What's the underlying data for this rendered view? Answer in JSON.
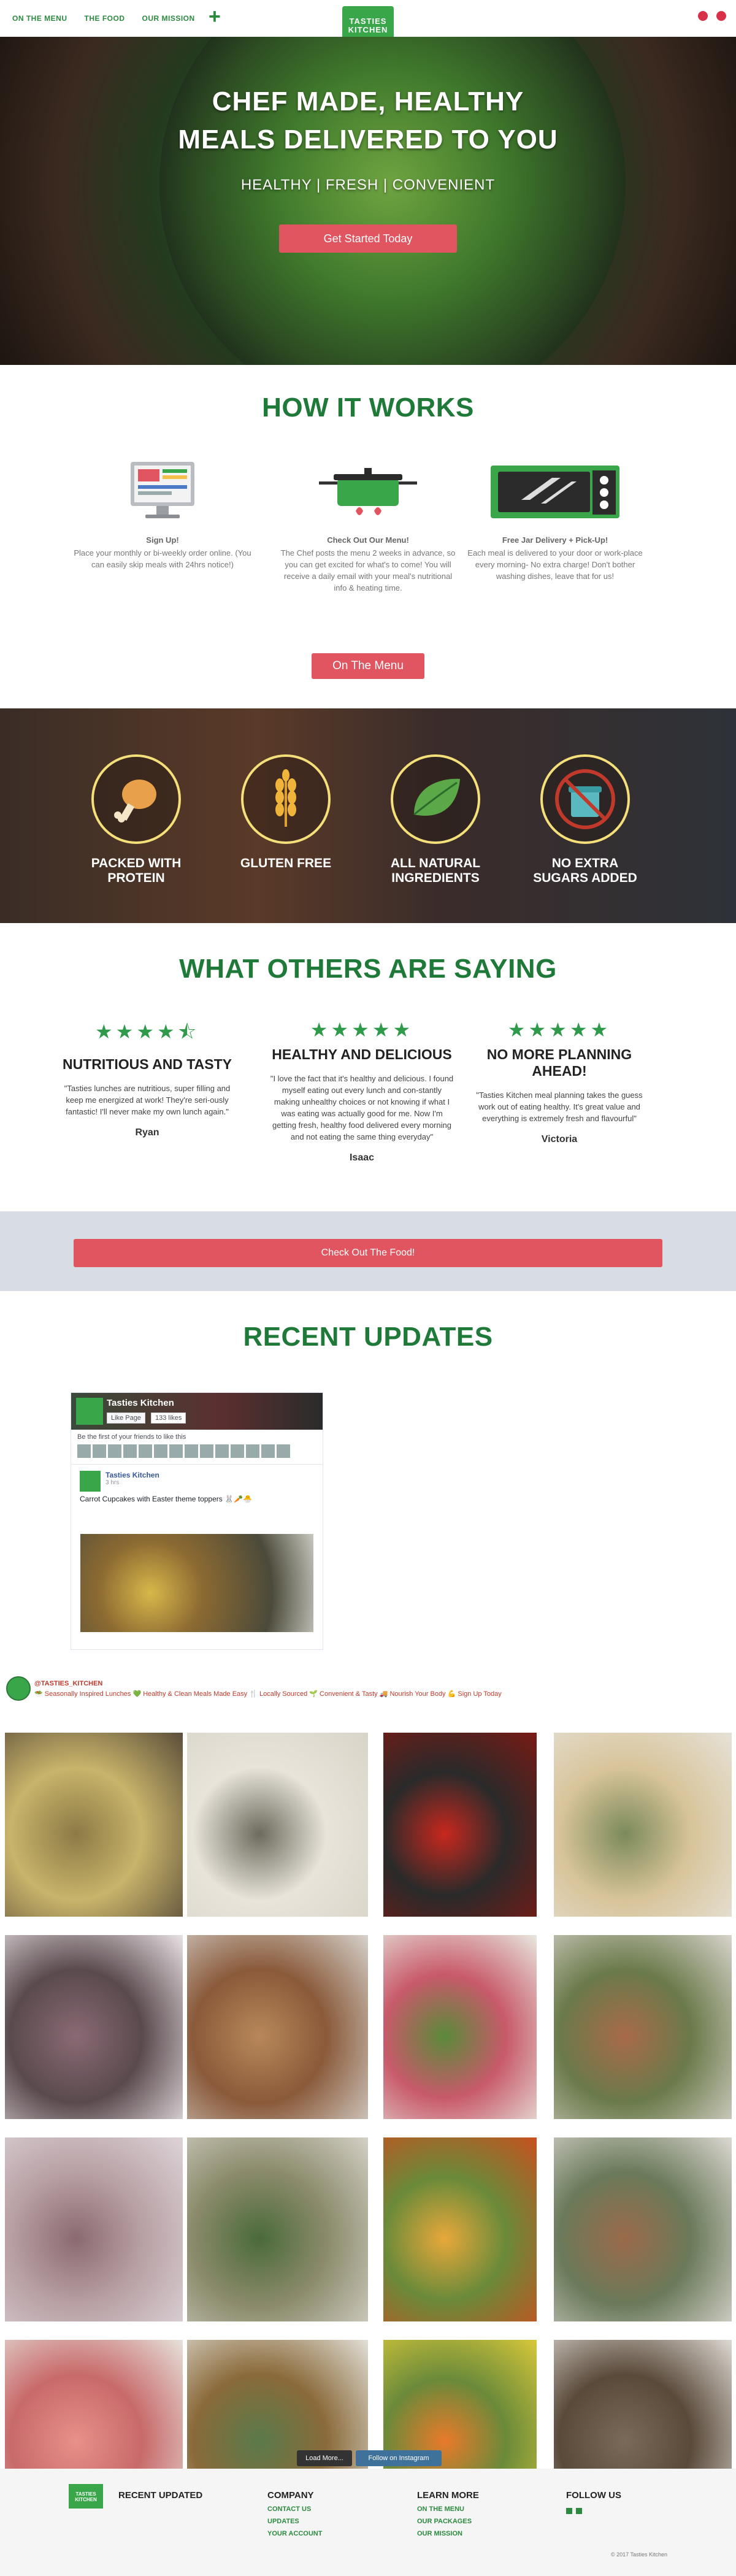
{
  "nav": {
    "items": [
      "ON THE MENU",
      "THE FOOD",
      "OUR MISSION"
    ],
    "logo_line1": "TASTIES",
    "logo_line2": "KITCHEN"
  },
  "hero": {
    "title_line1": "CHEF MADE, HEALTHY",
    "title_line2": "MEALS DELIVERED TO YOU",
    "subtitle": "HEALTHY | FRESH | CONVENIENT",
    "button": "Get Started Today"
  },
  "how": {
    "title": "HOW IT WORKS",
    "steps": [
      {
        "heading": "Sign Up!",
        "text": "Place your monthly or bi-weekly order online. (You can easily skip meals with 24hrs notice!)",
        "icon": "computer-icon"
      },
      {
        "heading": "Check Out Our Menu!",
        "text": "The Chef posts the menu 2 weeks in advance, so you can get excited for what's to come! You will receive a daily email with your meal's nutritional info & heating time.",
        "icon": "pot-icon"
      },
      {
        "heading": "Free Jar Delivery + Pick-Up!",
        "text": "Each meal is delivered to your door or work-place every morning- No extra charge! Don't bother washing dishes, leave that for us!",
        "icon": "microwave-icon"
      }
    ],
    "button": "On The Menu"
  },
  "features": [
    {
      "label": "PACKED WITH PROTEIN",
      "icon": "drumstick-icon"
    },
    {
      "label": "GLUTEN FREE",
      "icon": "wheat-icon"
    },
    {
      "label": "ALL NATURAL INGREDIENTS",
      "icon": "leaf-icon"
    },
    {
      "label": "NO EXTRA SUGARS ADDED",
      "icon": "no-sugar-icon"
    }
  ],
  "testimonials": {
    "title": "WHAT OTHERS ARE SAYING",
    "items": [
      {
        "stars": "★★★★⯪",
        "heading": "NUTRITIOUS AND TASTY",
        "text": "\"Tasties lunches are nutritious, super filling and keep me energized at work! They're seri-ously fantastic! I'll never make my own lunch again.\"",
        "name": "Ryan"
      },
      {
        "stars": "★★★★★",
        "heading": "HEALTHY AND DELICIOUS",
        "text": "\"I love the fact that it's healthy and delicious. I found myself eating out every lunch and con-stantly making unhealthy choices or not knowing if what I was eating was actually good for me. Now I'm getting fresh, healthy food delivered every morning and not eating the same thing everyday\"",
        "name": "Isaac"
      },
      {
        "stars": "★★★★★",
        "heading": "NO MORE PLANNING AHEAD!",
        "text": "\"Tasties Kitchen meal planning takes the guess work out of eating healthy. It's great value and everything is extremely fresh and flavourful\"",
        "name": "Victoria"
      }
    ]
  },
  "cta": {
    "button": "Check Out The Food!"
  },
  "updates": {
    "title": "RECENT UPDATES",
    "fb": {
      "page_name": "Tasties Kitchen",
      "like": "Like Page",
      "likes": "133 likes",
      "friends": "Be the first of your friends to like this",
      "post_name": "Tasties Kitchen",
      "post_time": "3 hrs",
      "post_text": "Carrot Cupcakes with Easter theme toppers 🐰🥕🐣"
    }
  },
  "instagram": {
    "user": "@TASTIES_KITCHEN",
    "bio": "🥗 Seasonally Inspired Lunches 💚 Healthy & Clean Meals Made Easy 🍴 Locally Sourced 🌱 Convenient & Tasty 🚚 Nourish Your Body 💪 Sign Up Today",
    "load_more": "Load More...",
    "follow": "Follow on Instagram",
    "photos": [
      {
        "colors": [
          "#5b4d3a",
          "#8c7a46",
          "#c8b46a"
        ]
      },
      {
        "colors": [
          "#d9d4c8",
          "#6d6a5e",
          "#e8e4da"
        ]
      },
      {
        "colors": [
          "#7a1a14",
          "#c8281e",
          "#2a2a2a"
        ]
      },
      {
        "colors": [
          "#e6e2d8",
          "#7b8a5a",
          "#d8c49a"
        ]
      },
      {
        "colors": [
          "#e9e2e4",
          "#8a6a74",
          "#5a4a4e"
        ]
      },
      {
        "colors": [
          "#d6d2cc",
          "#b8885a",
          "#8a5a3a"
        ]
      },
      {
        "colors": [
          "#e8e8e0",
          "#5a8a3a",
          "#c85a6a"
        ]
      },
      {
        "colors": [
          "#d8d4cc",
          "#a86a4a",
          "#6a7a4a"
        ]
      },
      {
        "colors": [
          "#ddd4d8",
          "#8a6a70",
          "#b8a0a4"
        ]
      },
      {
        "colors": [
          "#d4d0c6",
          "#4a6a3a",
          "#8a8a6a"
        ]
      },
      {
        "colors": [
          "#c8501e",
          "#e8a83a",
          "#6a8a3a"
        ]
      },
      {
        "colors": [
          "#dcd8d2",
          "#9a6a4a",
          "#6a7a5a"
        ]
      },
      {
        "colors": [
          "#e6e2dc",
          "#e8908a",
          "#c86a6a"
        ]
      },
      {
        "colors": [
          "#e2e0d8",
          "#5a7a4a",
          "#8a6a3a"
        ]
      },
      {
        "colors": [
          "#d8c83a",
          "#e87a2a",
          "#6a8a3a"
        ]
      },
      {
        "colors": [
          "#dedad4",
          "#7a6a5a",
          "#5a4a3a"
        ]
      }
    ]
  },
  "footer": {
    "logo_line1": "TASTIES",
    "logo_line2": "KITCHEN",
    "recent": "RECENT UPDATED",
    "company": {
      "title": "COMPANY",
      "links": [
        "CONTACT US",
        "UPDATES",
        "YOUR ACCOUNT"
      ]
    },
    "learn": {
      "title": "LEARN MORE",
      "links": [
        "ON THE MENU",
        "OUR PACKAGES",
        "OUR MISSION"
      ]
    },
    "follow": "FOLLOW US",
    "copyright": "© 2017 Tasties Kitchen"
  },
  "colors": {
    "brand_green": "#2b8a3e",
    "accent_red": "#e0555f",
    "star_green": "#2e9a4a"
  }
}
